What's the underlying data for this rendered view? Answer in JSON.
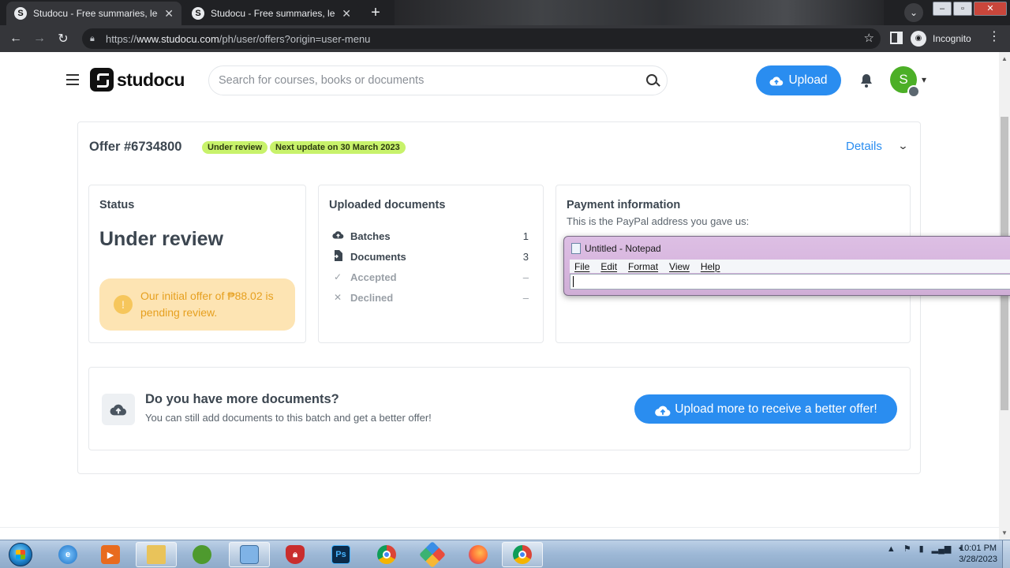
{
  "browser": {
    "tabs": [
      {
        "title": "Studocu - Free summaries, lectur"
      },
      {
        "title": "Studocu - Free summaries, lectur"
      }
    ],
    "url_scheme": "https://",
    "url_host": "www.studocu.com",
    "url_path": "/ph/user/offers?origin=user-menu",
    "profile_label": "Incognito"
  },
  "header": {
    "logo_text": "studocu",
    "search_placeholder": "Search for courses, books or documents",
    "upload_label": "Upload",
    "avatar_letter": "S"
  },
  "offer": {
    "title": "Offer #6734800",
    "status_pill": "Under review",
    "update_pill": "Next update on 30 March 2023",
    "details_label": "Details"
  },
  "status_box": {
    "heading": "Status",
    "value": "Under review",
    "alert_text": "Our initial offer of ₱88.02 is pending review."
  },
  "uploaded_box": {
    "heading": "Uploaded documents",
    "rows": [
      {
        "label": "Batches",
        "value": "1"
      },
      {
        "label": "Documents",
        "value": "3"
      },
      {
        "label": "Accepted",
        "value": "–"
      },
      {
        "label": "Declined",
        "value": "–"
      }
    ]
  },
  "payment_box": {
    "heading": "Payment information",
    "subtitle": "This is the PayPal address you gave us:"
  },
  "more_docs": {
    "title": "Do you have more documents?",
    "subtitle": "You can still add documents to this batch and get a better offer!",
    "button_label": "Upload more to receive a better offer!"
  },
  "notepad": {
    "title": "Untitled - Notepad",
    "menu": [
      "File",
      "Edit",
      "Format",
      "View",
      "Help"
    ]
  },
  "taskbar": {
    "time": "10:01 PM",
    "date": "3/28/2023"
  },
  "colors": {
    "accent": "#2a8df0",
    "pill": "#c8f26b",
    "alert_bg": "#fde4b3",
    "alert_text": "#e6a020",
    "avatar": "#4caf27"
  }
}
